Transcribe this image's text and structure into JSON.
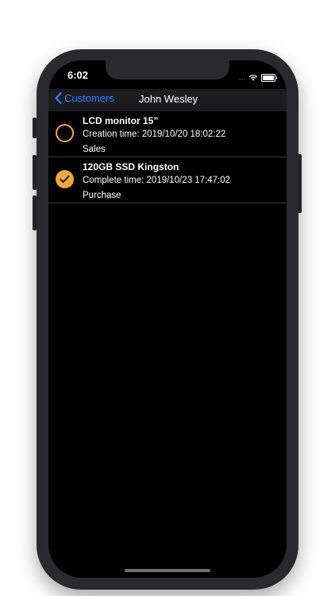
{
  "status_bar": {
    "time": "6:02",
    "signal": "....",
    "wifi_icon": "wifi-icon",
    "battery_icon": "battery-icon",
    "battery_level": 1.0
  },
  "nav": {
    "back_label": "Customers",
    "title": "John Wesley"
  },
  "colors": {
    "accent": "#f0a83a",
    "link": "#2f7cf6",
    "background": "#000000",
    "nav_background": "#1c1c1e"
  },
  "items": [
    {
      "title": "LCD monitor 15”",
      "time_line": "Creation time: 2019/10/20 18:02:22",
      "type": "Sales",
      "checked": false
    },
    {
      "title": "120GB SSD Kingston",
      "time_line": "Complete time: 2019/10/23 17:47:02",
      "type": "Purchase",
      "checked": true
    }
  ]
}
